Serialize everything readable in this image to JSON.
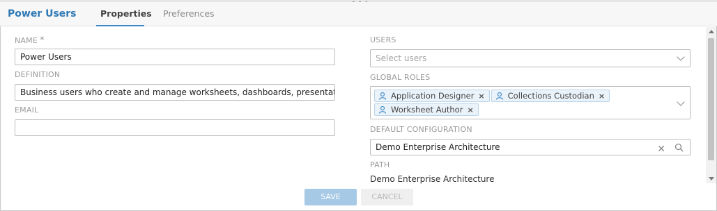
{
  "header": {
    "title": "Power Users",
    "tabs": [
      {
        "label": "Properties",
        "active": true
      },
      {
        "label": "Preferences",
        "active": false
      }
    ]
  },
  "form": {
    "name": {
      "label": "NAME",
      "required_marker": "*",
      "value": "Power Users"
    },
    "definition": {
      "label": "DEFINITION",
      "value": "Business users who create and manage worksheets, dashboards, presentations ar"
    },
    "email": {
      "label": "EMAIL",
      "value": ""
    },
    "users": {
      "label": "USERS",
      "placeholder": "Select users"
    },
    "global_roles": {
      "label": "GLOBAL ROLES",
      "chips": [
        {
          "label": "Application Designer",
          "icon": "user-icon",
          "remove": "×"
        },
        {
          "label": "Collections Custodian",
          "icon": "user-icon",
          "remove": "×"
        },
        {
          "label": "Worksheet Author",
          "icon": "user-icon",
          "remove": "×"
        }
      ]
    },
    "default_configuration": {
      "label": "DEFAULT CONFIGURATION",
      "value": "Demo Enterprise Architecture",
      "clear": "✕"
    },
    "path": {
      "label": "PATH",
      "value": "Demo Enterprise Architecture"
    }
  },
  "actions": {
    "save": "SAVE",
    "cancel": "CANCEL"
  },
  "colors": {
    "accent": "#2f79b5",
    "tab_underline": "#3d8bc6",
    "chip_bg": "#eaf2fa",
    "save_bg": "#a6c9e6"
  }
}
